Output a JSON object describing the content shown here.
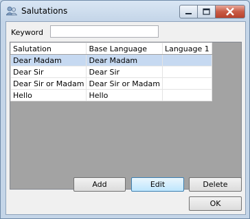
{
  "window": {
    "title": "Salutations"
  },
  "filter": {
    "label": "Keyword",
    "value": ""
  },
  "grid": {
    "columns": [
      "Salutation",
      "Base Language",
      "Language 1"
    ],
    "rows": [
      [
        "Dear Madam",
        "Dear Madam",
        ""
      ],
      [
        "Dear Sir",
        "Dear Sir",
        ""
      ],
      [
        "Dear Sir or Madam",
        "Dear Sir or Madam",
        ""
      ],
      [
        "Hello",
        "Hello",
        ""
      ]
    ],
    "selected_row": 0
  },
  "buttons": {
    "add": "Add",
    "edit": "Edit",
    "delete": "Delete",
    "ok": "OK"
  },
  "icons": {
    "title": "users-icon",
    "minimize": "minimize-icon",
    "maximize": "maximize-icon",
    "close": "close-icon"
  }
}
